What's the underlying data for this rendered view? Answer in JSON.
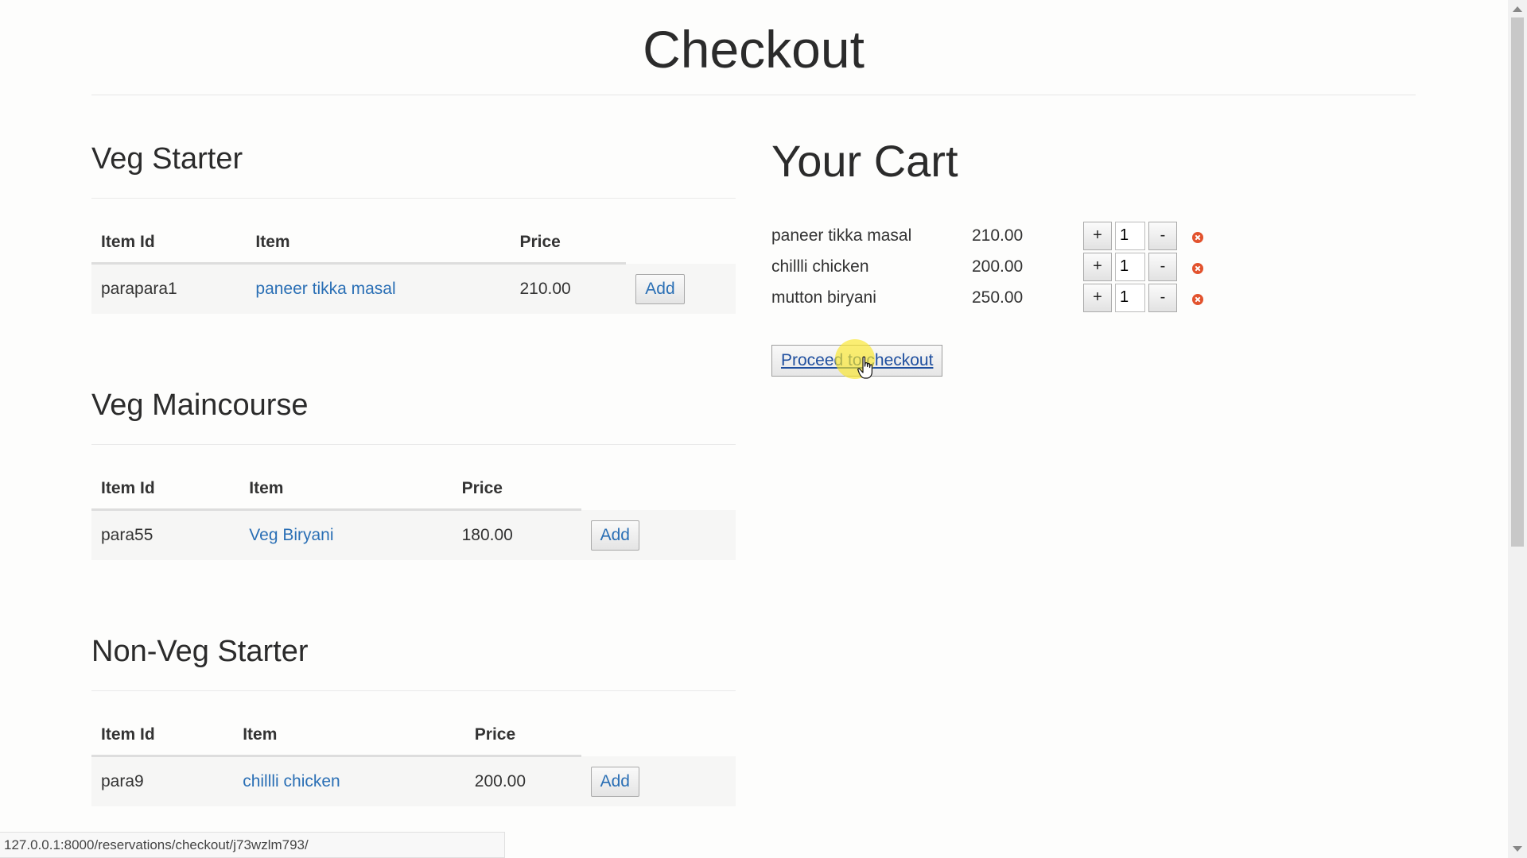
{
  "page": {
    "title": "Checkout"
  },
  "sections": [
    {
      "heading": "Veg Starter",
      "headers": {
        "id": "Item Id",
        "item": "Item",
        "price": "Price"
      },
      "rows": [
        {
          "id": "parapara1",
          "item": "paneer tikka masal",
          "price": "210.00",
          "action": "Add"
        }
      ]
    },
    {
      "heading": "Veg Maincourse",
      "headers": {
        "id": "Item Id",
        "item": "Item",
        "price": "Price"
      },
      "rows": [
        {
          "id": "para55",
          "item": "Veg Biryani",
          "price": "180.00",
          "action": "Add"
        }
      ]
    },
    {
      "heading": "Non-Veg Starter",
      "headers": {
        "id": "Item Id",
        "item": "Item",
        "price": "Price"
      },
      "rows": [
        {
          "id": "para9",
          "item": "chillli chicken",
          "price": "200.00",
          "action": "Add"
        }
      ]
    }
  ],
  "cart": {
    "title": "Your Cart",
    "items": [
      {
        "name": "paneer tikka masal",
        "price": "210.00",
        "qty": "1",
        "plus": "+",
        "minus": "-"
      },
      {
        "name": "chillli chicken",
        "price": "200.00",
        "qty": "1",
        "plus": "+",
        "minus": "-"
      },
      {
        "name": "mutton biryani",
        "price": "250.00",
        "qty": "1",
        "plus": "+",
        "minus": "-"
      }
    ],
    "proceed_label": "Proceed to checkout",
    "remove_icon": "remove-circle-icon",
    "remove_color": "#e2522d"
  },
  "status_bar": {
    "url": "127.0.0.1:8000/reservations/checkout/j73wzlm793/"
  }
}
